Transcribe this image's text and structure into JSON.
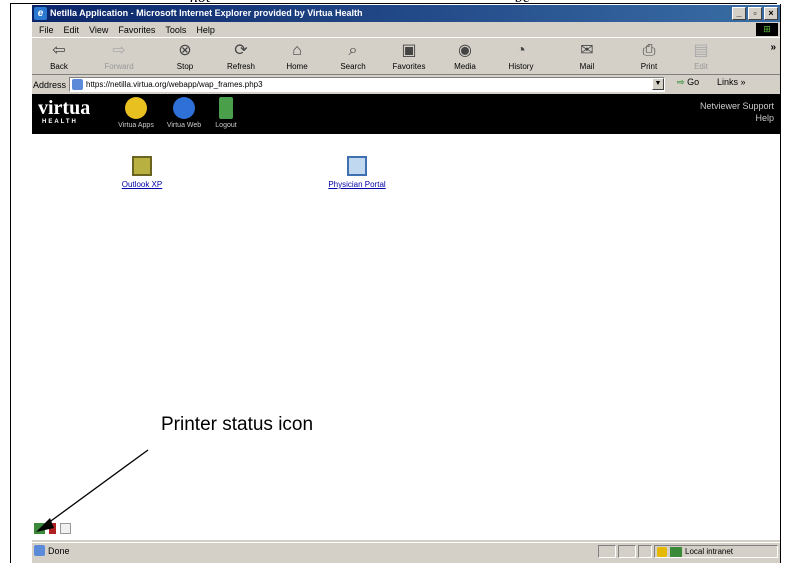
{
  "caption_top": {
    "left_fragment": "not",
    "right_fragment": "be"
  },
  "window": {
    "title": "Netilla Application - Microsoft Internet Explorer provided by Virtua Health",
    "controls": {
      "minimize": "_",
      "restore": "▫",
      "close": "×"
    }
  },
  "menu": [
    {
      "label": "File"
    },
    {
      "label": "Edit"
    },
    {
      "label": "View"
    },
    {
      "label": "Favorites"
    },
    {
      "label": "Tools"
    },
    {
      "label": "Help"
    }
  ],
  "toolbar": {
    "buttons": [
      {
        "label": "Back",
        "icon": "back-arrow-icon",
        "glyph": "⇦"
      },
      {
        "label": "Forward",
        "icon": "forward-arrow-icon",
        "glyph": "⇨"
      },
      {
        "label": "Stop",
        "icon": "stop-icon",
        "glyph": "⊗"
      },
      {
        "label": "Refresh",
        "icon": "refresh-icon",
        "glyph": "⟳"
      },
      {
        "label": "Home",
        "icon": "home-icon",
        "glyph": "⌂"
      },
      {
        "label": "Search",
        "icon": "search-icon",
        "glyph": "⌕"
      },
      {
        "label": "Favorites",
        "icon": "favorites-icon",
        "glyph": "▣"
      },
      {
        "label": "Media",
        "icon": "media-icon",
        "glyph": "◉"
      },
      {
        "label": "History",
        "icon": "history-icon",
        "glyph": "◔"
      },
      {
        "label": "Mail",
        "icon": "mail-icon",
        "glyph": "✉"
      },
      {
        "label": "Print",
        "icon": "print-icon",
        "glyph": "⎙"
      },
      {
        "label": "Edit",
        "icon": "edit-icon",
        "glyph": "▤"
      }
    ],
    "overflow": "»"
  },
  "address": {
    "label": "Address",
    "url": "https://netilla.virtua.org/webapp/wap_frames.php3",
    "go_label": "Go",
    "links_label": "Links »"
  },
  "banner": {
    "logo": "virtua",
    "logo_sub": "HEALTH",
    "apps": [
      {
        "label": "Virtua Apps",
        "icon": "virtua-apps-icon",
        "color": "#e8c020"
      },
      {
        "label": "Virtua Web",
        "icon": "globe-icon",
        "color": "#2f6fd8"
      },
      {
        "label": "Logout",
        "icon": "logout-door-icon",
        "color": "#4aa04a"
      }
    ],
    "right_line1": "Netviewer Support",
    "right_line2": "Help"
  },
  "applications": [
    {
      "label": "Outlook XP",
      "icon": "outlook-icon"
    },
    {
      "label": "Physician Portal",
      "icon": "physician-portal-icon"
    }
  ],
  "annotation": {
    "text": "Printer status icon"
  },
  "statusbar": {
    "status_text": "Done",
    "zone_text": "Local intranet"
  }
}
